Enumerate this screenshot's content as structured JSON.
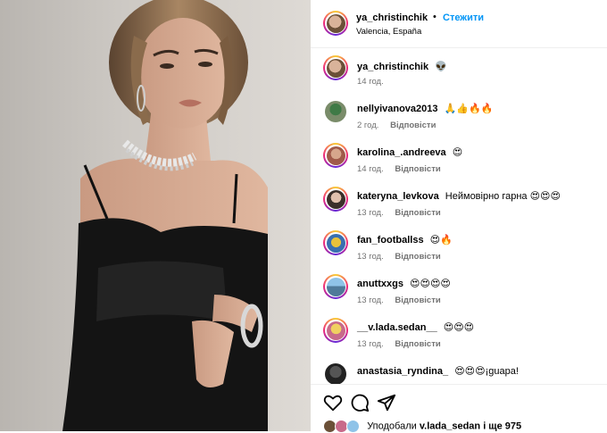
{
  "post": {
    "author": "ya_christinchik",
    "follow_label": "Стежити",
    "location": "Valencia, España",
    "dot": "•"
  },
  "caption": {
    "username": "ya_christinchik",
    "text": "👽",
    "time": "14 год."
  },
  "comments": [
    {
      "username": "nellyivanova2013",
      "text": "🙏👍🔥🔥",
      "time": "2 год.",
      "reply": "Відповісти"
    },
    {
      "username": "karolina_.andreeva",
      "text": "😍",
      "time": "14 год.",
      "reply": "Відповісти"
    },
    {
      "username": "kateryna_levkova",
      "text": "Неймовірно гарна 😍😍😍",
      "time": "13 год.",
      "reply": "Відповісти"
    },
    {
      "username": "fan_footballss",
      "text": "😍🔥",
      "time": "13 год.",
      "reply": "Відповісти"
    },
    {
      "username": "anuttxxgs",
      "text": "😍😍😍😍",
      "time": "13 год.",
      "reply": "Відповісти"
    },
    {
      "username": "__v.lada.sedan__",
      "text": "😍😍😍",
      "time": "13 год.",
      "reply": "Відповісти"
    },
    {
      "username": "anastasia_ryndina_",
      "text": "😍😍😍¡guapa!",
      "time": "",
      "reply": ""
    }
  ],
  "likes": {
    "prefix": "Уподобали",
    "user": "v.lada_sedan",
    "suffix": "і ще 975"
  },
  "icons": [
    "heart-icon",
    "comment-icon",
    "share-icon"
  ],
  "colors": {
    "accent": "#0095f6",
    "meta": "#737373"
  }
}
